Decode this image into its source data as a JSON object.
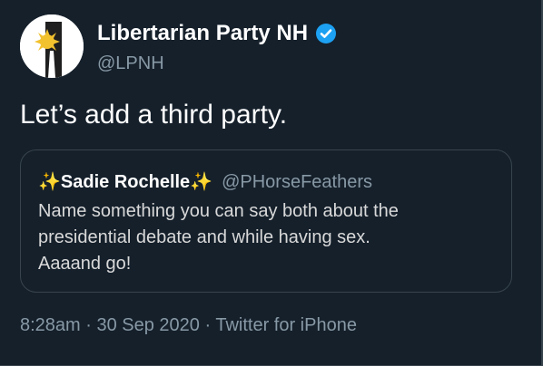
{
  "author": {
    "display_name": "Libertarian Party NH",
    "handle": "@LPNH",
    "verified": true,
    "avatar_icon": "party-logo-icon"
  },
  "tweet": {
    "text": "Let’s add a third party."
  },
  "quoted_tweet": {
    "sparkle_left": "✨",
    "display_name": "Sadie Rochelle",
    "sparkle_right": "✨",
    "handle": "@PHorseFeathers",
    "lines": [
      "Name something you can say both about the",
      "presidential debate and while having sex.",
      "Aaaand go!"
    ]
  },
  "meta": {
    "text": "8:28am · 30 Sep 2020 · Twitter for iPhone"
  },
  "colors": {
    "background": "#15202b",
    "primary_text": "#ffffff",
    "secondary_text": "#8899a6",
    "border": "#38444d",
    "verified_badge": "#1da1f2",
    "sparkle": "#ffd53e"
  }
}
